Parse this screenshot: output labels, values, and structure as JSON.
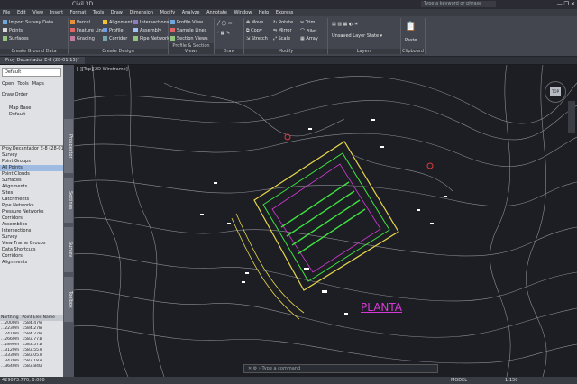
{
  "titlebar": {
    "title": "Civil 3D",
    "search_placeholder": "Type a keyword or phrase",
    "window_controls": "— ❐ ✕"
  },
  "menu": [
    "File",
    "Edit",
    "View",
    "Insert",
    "Format",
    "Tools",
    "Draw",
    "Dimension",
    "Modify",
    "Analyze",
    "Annotate",
    "Window",
    "Help",
    "Express"
  ],
  "ribbon_tabs": [
    "Home",
    "Insert",
    "Annotate",
    "Modify",
    "Analyze",
    "View",
    "Manage",
    "Output",
    "Survey",
    "Autodesk 360",
    "Help",
    "Add-ins",
    "Raster Tools",
    "Geotechnics",
    "Featured Apps",
    "Express Tools"
  ],
  "ribbon": {
    "ground": {
      "label": "Create Ground Data",
      "cmds": [
        "Import Survey Data",
        "Points",
        "Surfaces"
      ]
    },
    "design": {
      "label": "Create Design",
      "cmds": [
        "Parcel",
        "Feature Line",
        "Grading",
        "Alignment",
        "Profile",
        "Corridor",
        "Intersections",
        "Assembly",
        "Pipe Network"
      ]
    },
    "profile": {
      "label": "Profile & Section Views",
      "cmds": [
        "Profile View",
        "Sample Lines",
        "Section Views"
      ]
    },
    "draw": {
      "label": "Draw"
    },
    "modify": {
      "label": "Modify",
      "cmds": [
        "Move",
        "Copy",
        "Stretch",
        "Rotate",
        "Mirror",
        "Scale",
        "Trim",
        "Fillet",
        "Array"
      ]
    },
    "layers": {
      "label": "Layers",
      "cmds": [
        "Unsaved Layer State"
      ]
    },
    "clipboard": {
      "label": "Clipboard",
      "cmds": [
        "Paste"
      ]
    }
  },
  "doc_tabs": [
    "Proy Decantador E-8 (28-01-15)*"
  ],
  "left_pane": {
    "dropdown": "Default",
    "icons": [
      "Open",
      "Tools",
      "Maps"
    ],
    "draw_order": "Draw Order",
    "map_base": "Map Base",
    "default": "Default",
    "tree_header": "Proy.Decantador E-8 (28-01-1...",
    "tree": [
      "Proy.Decantador E-8 (28-01-1...",
      "Survey",
      "Point Groups",
      "All Points",
      "Point Clouds",
      "Surfaces",
      "Alignments",
      "Sites",
      "Catchments",
      "Pipe Networks",
      "Pressure Networks",
      "Corridors",
      "Assemblies",
      "Intersections",
      "Survey",
      "View Frame Groups",
      "Data Shortcuts",
      "Corridors",
      "Alignments"
    ],
    "selected_index": 3
  },
  "vertical_tabs": [
    "Prospector",
    "Settings",
    "Survey",
    "Toolbox"
  ],
  "viewport_label": "[-][Top][2D Wireframe]",
  "drawing_text": "PLANTA",
  "point_table": {
    "headers": [
      "Northing",
      "Point Elevati...",
      "Name"
    ],
    "rows": [
      [
        "...2000m",
        "1584.479m",
        ""
      ],
      [
        "...2230m",
        "1584.278m",
        ""
      ],
      [
        "...2410m",
        "1584.278m",
        ""
      ],
      [
        "...2660m",
        "1583.771m",
        ""
      ],
      [
        "...2890m",
        "1583.571m",
        ""
      ],
      [
        "...3120m",
        "1583.557m",
        ""
      ],
      [
        "...3330m",
        "1583.057m",
        ""
      ],
      [
        "...3470m",
        "1583.183m",
        ""
      ],
      [
        "...3640m",
        "1583.840m",
        ""
      ]
    ]
  },
  "command_line": "Type a command",
  "status": {
    "coords": "429073.770, 0.000",
    "model": "MODEL",
    "scale": "1:150"
  },
  "colors": {
    "canvas": "#1c1e24",
    "contours": "#8d8f95",
    "accent_yellow": "#e6d64a",
    "accent_green": "#3fe23f",
    "accent_magenta": "#d63ad6",
    "accent_red": "#e03a3a"
  }
}
